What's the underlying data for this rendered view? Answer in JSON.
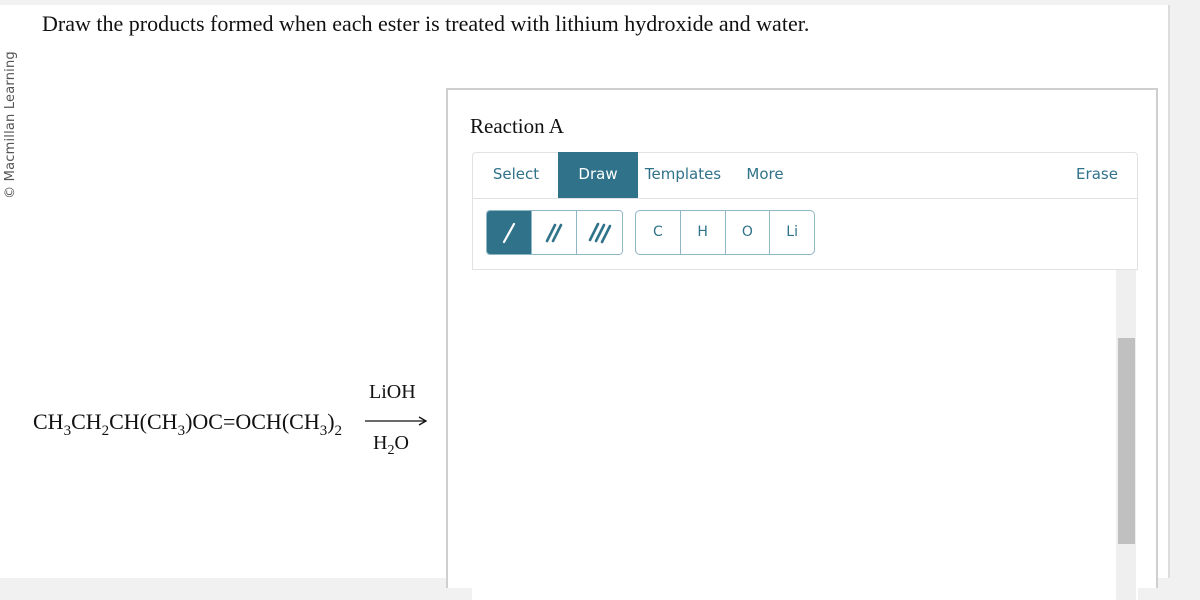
{
  "copyright": "© Macmillan Learning",
  "question": "Draw the products formed when each ester is treated with lithium hydroxide and water.",
  "reaction": {
    "formula_parts": [
      {
        "t": "CH"
      },
      {
        "s": "3"
      },
      {
        "t": "CH"
      },
      {
        "s": "2"
      },
      {
        "t": "CH(CH"
      },
      {
        "s": "3"
      },
      {
        "t": ")OC=OCH(CH"
      },
      {
        "s": "3"
      },
      {
        "t": ")"
      },
      {
        "s": "2"
      }
    ],
    "reagent_top": "LiOH",
    "reagent_bottom_main": "H",
    "reagent_bottom_sub": "2",
    "reagent_bottom_tail": "O"
  },
  "panel": {
    "title": "Reaction A",
    "tabs": {
      "select": "Select",
      "draw": "Draw",
      "templates": "Templates",
      "more": "More",
      "erase": "Erase"
    },
    "active_tab": "Draw",
    "bond_tools": [
      {
        "name": "single-bond",
        "icon": "single-bond-icon",
        "active": true
      },
      {
        "name": "double-bond",
        "icon": "double-bond-icon",
        "active": false
      },
      {
        "name": "triple-bond",
        "icon": "triple-bond-icon",
        "active": false
      }
    ],
    "atoms": [
      "C",
      "H",
      "O",
      "Li"
    ]
  },
  "colors": {
    "accent": "#2f7289",
    "border": "#8fb6c4",
    "background": "#f1f1f1"
  }
}
